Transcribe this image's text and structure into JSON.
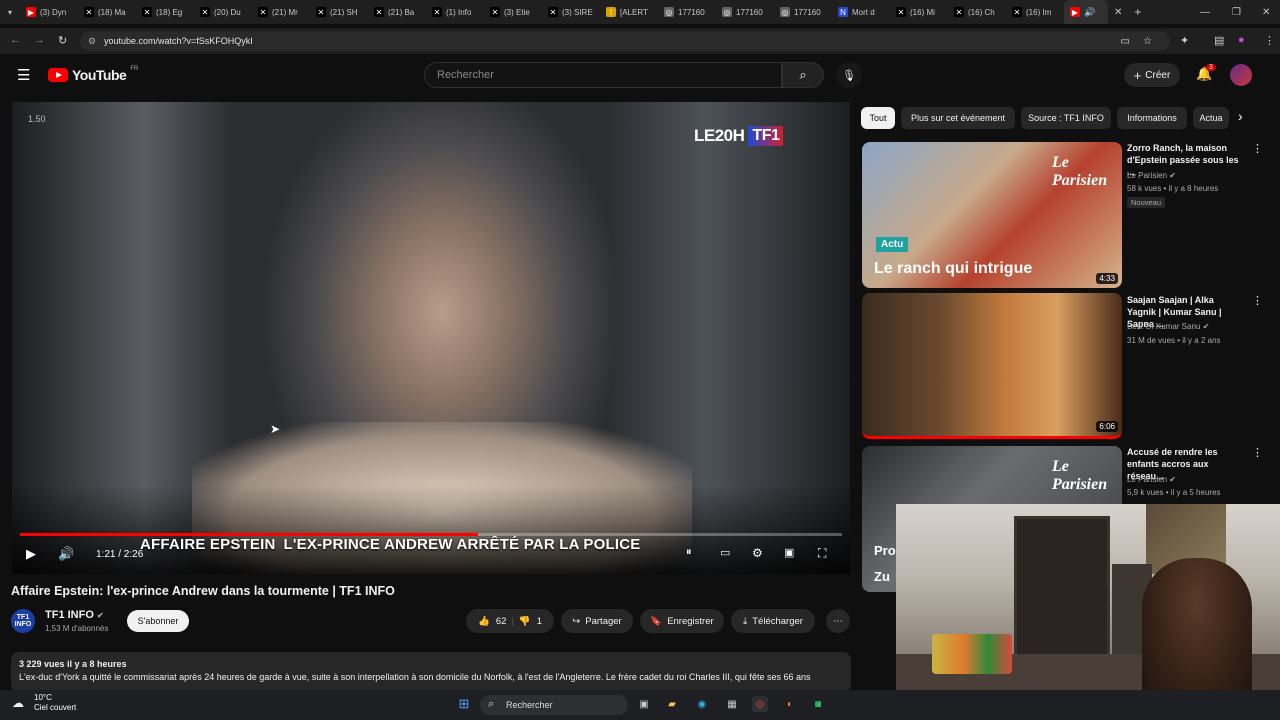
{
  "browser": {
    "tabs": [
      {
        "label": "(3) Dyn",
        "icon": "youtube-icon"
      },
      {
        "label": "(18) Ma",
        "icon": "x-icon"
      },
      {
        "label": "(18) Eg",
        "icon": "x-icon"
      },
      {
        "label": "(20) Du",
        "icon": "x-icon"
      },
      {
        "label": "(21) Mr",
        "icon": "x-icon"
      },
      {
        "label": "(21) SH",
        "icon": "x-icon"
      },
      {
        "label": "(21) Ba",
        "icon": "x-icon"
      },
      {
        "label": "(1) Info",
        "icon": "x-icon"
      },
      {
        "label": "(3) Etie",
        "icon": "x-icon"
      },
      {
        "label": "(3) SIRE",
        "icon": "x-icon"
      },
      {
        "label": "[ALERT",
        "icon": "alert-icon"
      },
      {
        "label": "177160",
        "icon": "globe-icon"
      },
      {
        "label": "177160",
        "icon": "globe-icon"
      },
      {
        "label": "177160",
        "icon": "globe-icon"
      },
      {
        "label": "Mort d",
        "icon": "news-icon"
      },
      {
        "label": "(16) Mi",
        "icon": "x-icon"
      },
      {
        "label": "(16) Ch",
        "icon": "x-icon"
      },
      {
        "label": "(16) Im",
        "icon": "x-icon"
      }
    ],
    "url": "youtube.com/watch?v=fSsKFOHQykI"
  },
  "header": {
    "logo_text": "YouTube",
    "country": "FR",
    "search_placeholder": "Rechercher",
    "create_label": "Créer",
    "notif_count": "3"
  },
  "player": {
    "brand_text": "LE20H",
    "brand_tf1": "TF1",
    "timecode_small": "1.50",
    "headline_part1": "AFFAIRE EPSTEIN",
    "headline_part2": "L'EX-PRINCE ANDREW ARRÊTÉ PAR LA POLICE",
    "time_display": "1:21 / 2:26",
    "progress_fraction": 0.557
  },
  "video": {
    "title": "Affaire Epstein: l'ex-prince Andrew dans la tourmente | TF1 INFO",
    "channel": "TF1 INFO",
    "channel_avatar_text": "TF1 INFO",
    "subscribers": "1,53 M d'abonnés",
    "subscribe_label": "S'abonner",
    "likes": "62",
    "dislikes": "1",
    "share_label": "Partager",
    "save_label": "Enregistrer",
    "download_label": "Télécharger",
    "views_meta": "3 229 vues  il y a 8 heures",
    "description": "L'ex-duc d'York a quitté le commissariat après 24 heures de garde à vue, suite à son interpellation à son domicile du Norfolk, à l'est de l'Angleterre. Le frère cadet du roi Charles III, qui fête ses 66 ans"
  },
  "sidebar": {
    "chips": [
      "Tout",
      "Plus sur cet événement",
      "Source : TF1 INFO",
      "Informations",
      "Actua"
    ],
    "videos": [
      {
        "title": "Zorro Ranch, la maison d'Epstein passée sous les ...",
        "channel": "Le Parisien",
        "meta": "58 k vues • il y a 8 heures",
        "badge": "Nouveau",
        "duration": "4:33",
        "overlay_tag": "Actu",
        "overlay_text": "Le ranch qui intrigue",
        "watermark": "Le Parisien"
      },
      {
        "title": "Saajan Saajan | Alka Yagnik | Kumar Sanu | Sapna ...",
        "channel": "Best Of Kumar Sanu",
        "meta": "31 M de vues • il y a 2 ans",
        "duration": "6:06"
      },
      {
        "title": "Accusé de rendre les enfants accros aux réseau...",
        "channel": "Le Parisien",
        "meta": "5,9 k vues • il y a 5 heures",
        "watermark": "Le Parisien",
        "overlay_text": "Pro Zu"
      }
    ]
  },
  "taskbar": {
    "temp": "10°C",
    "weather": "Ciel couvert",
    "search_label": "Rechercher"
  },
  "colors": {
    "yt_red": "#ff0000",
    "bg": "#0f0f0f",
    "chip_bg": "#272727"
  }
}
